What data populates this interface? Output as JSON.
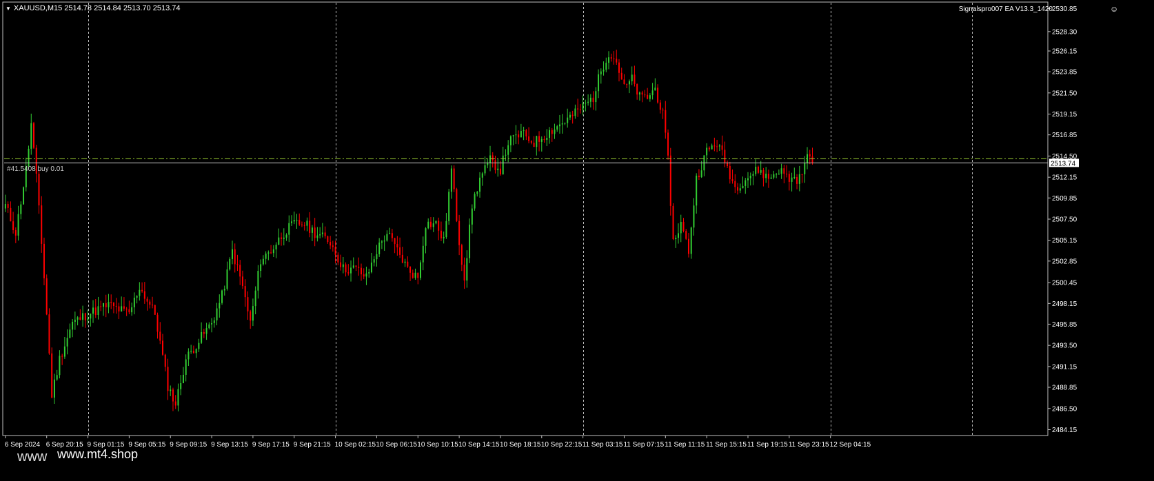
{
  "window": {
    "symbol_header": "XAUUSD,M15",
    "ohlc": "2514.78 2514.84 2513.70 2513.74",
    "header_combined": "XAUUSD,M15  2514.78 2514.84 2513.70 2513.74",
    "ea_label": "Signalspro007 EA  V13.3_1420",
    "ea_icon": "smiley-icon",
    "dropdown_icon": "triangle-down-icon"
  },
  "overlay": {
    "watermark_prefix": "www",
    "watermark": "www.mt4.shop",
    "order_label": "#41.5408 buy 0.01"
  },
  "colors": {
    "background": "#000000",
    "bull_candle": "#32CD32",
    "bear_candle": "#FF0000",
    "grid": "#C0C0C0",
    "axis_text": "#FFFFFF",
    "price_line": "#C8C8C8",
    "order_line": "#9ACD32"
  },
  "chart_data": {
    "type": "candlestick",
    "symbol": "XAUUSD",
    "timeframe": "M15",
    "ylim": [
      2483.5,
      2531.5
    ],
    "y_ticks": [
      2530.85,
      2528.3,
      2526.15,
      2523.85,
      2521.5,
      2519.15,
      2516.85,
      2514.5,
      2512.15,
      2509.85,
      2507.5,
      2505.15,
      2502.85,
      2500.45,
      2498.15,
      2495.85,
      2493.5,
      2491.15,
      2488.85,
      2486.5,
      2484.15
    ],
    "current_price": 2513.74,
    "current_price_label": "2513.74",
    "order_price": 2514.2,
    "x_labels": [
      "6 Sep 2024",
      "6 Sep 20:15",
      "9 Sep 01:15",
      "9 Sep 05:15",
      "9 Sep 09:15",
      "9 Sep 13:15",
      "9 Sep 17:15",
      "9 Sep 21:15",
      "10 Sep 02:15",
      "10 Sep 06:15",
      "10 Sep 10:15",
      "10 Sep 14:15",
      "10 Sep 18:15",
      "10 Sep 22:15",
      "11 Sep 03:15",
      "11 Sep 07:15",
      "11 Sep 11:15",
      "11 Sep 15:15",
      "11 Sep 19:15",
      "11 Sep 23:15",
      "12 Sep 04:15"
    ],
    "bars_per_label": 16,
    "day_separator_label_indices": [
      2,
      8,
      14,
      20
    ],
    "trailing_separator_bar": 375,
    "anchors": [
      [
        0,
        2509
      ],
      [
        4,
        2506
      ],
      [
        8,
        2513
      ],
      [
        10,
        2518
      ],
      [
        13,
        2509
      ],
      [
        16,
        2497
      ],
      [
        18,
        2488
      ],
      [
        21,
        2492
      ],
      [
        26,
        2496
      ],
      [
        32,
        2497
      ],
      [
        40,
        2498
      ],
      [
        48,
        2497
      ],
      [
        52,
        2500
      ],
      [
        58,
        2497
      ],
      [
        63,
        2489
      ],
      [
        66,
        2487
      ],
      [
        70,
        2492
      ],
      [
        75,
        2494
      ],
      [
        80,
        2496
      ],
      [
        84,
        2499
      ],
      [
        88,
        2504
      ],
      [
        92,
        2500
      ],
      [
        95,
        2496
      ],
      [
        99,
        2503
      ],
      [
        103,
        2504
      ],
      [
        108,
        2506
      ],
      [
        112,
        2507
      ],
      [
        116,
        2507
      ],
      [
        120,
        2506
      ],
      [
        126,
        2505
      ],
      [
        131,
        2502
      ],
      [
        136,
        2502
      ],
      [
        140,
        2501
      ],
      [
        144,
        2504
      ],
      [
        148,
        2506
      ],
      [
        152,
        2504
      ],
      [
        156,
        2502
      ],
      [
        160,
        2501
      ],
      [
        163,
        2507
      ],
      [
        167,
        2507
      ],
      [
        170,
        2505
      ],
      [
        173,
        2513
      ],
      [
        176,
        2505
      ],
      [
        178,
        2501
      ],
      [
        181,
        2509
      ],
      [
        184,
        2512
      ],
      [
        188,
        2514
      ],
      [
        192,
        2513
      ],
      [
        195,
        2516
      ],
      [
        200,
        2517
      ],
      [
        205,
        2516
      ],
      [
        210,
        2517
      ],
      [
        215,
        2518
      ],
      [
        220,
        2519
      ],
      [
        224,
        2520
      ],
      [
        228,
        2521
      ],
      [
        231,
        2524
      ],
      [
        234,
        2526
      ],
      [
        237,
        2525
      ],
      [
        240,
        2522
      ],
      [
        243,
        2523
      ],
      [
        246,
        2521
      ],
      [
        249,
        2521
      ],
      [
        252,
        2522
      ],
      [
        255,
        2519
      ],
      [
        257,
        2514
      ],
      [
        259,
        2505
      ],
      [
        262,
        2507
      ],
      [
        265,
        2504
      ],
      [
        268,
        2512
      ],
      [
        272,
        2515
      ],
      [
        276,
        2516
      ],
      [
        279,
        2514
      ],
      [
        283,
        2511
      ],
      [
        287,
        2512
      ],
      [
        292,
        2513
      ],
      [
        296,
        2512
      ],
      [
        300,
        2513
      ],
      [
        304,
        2512
      ],
      [
        308,
        2512
      ],
      [
        312,
        2515
      ],
      [
        313,
        2514.8
      ]
    ]
  }
}
